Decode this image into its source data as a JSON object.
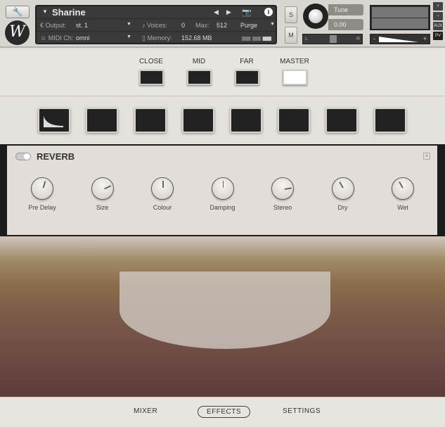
{
  "header": {
    "instrument_name": "Sharine",
    "output_label": "Output:",
    "output_value": "st. 1",
    "voices_label": "Voices:",
    "voices_value": "0",
    "max_label": "Max:",
    "max_value": "512",
    "midi_label": "MIDI Ch:",
    "midi_value": "omni",
    "memory_label": "Memory:",
    "memory_value": "152.68 MB",
    "purge_label": "Purge",
    "solo_label": "S",
    "mute_label": "M",
    "tune_label": "Tune",
    "tune_value": "0.00",
    "pan_left": "L",
    "pan_right": "R",
    "vol_minus": "-",
    "vol_plus": "+",
    "aux_label": "AUX",
    "pv_label": "PV",
    "close_glyph": "×",
    "min_glyph": "–",
    "logo": "W"
  },
  "mics": {
    "items": [
      {
        "label": "CLOSE",
        "active": false
      },
      {
        "label": "MID",
        "active": false
      },
      {
        "label": "FAR",
        "active": false
      },
      {
        "label": "MASTER",
        "active": true
      }
    ]
  },
  "effect": {
    "title": "REVERB",
    "enabled": true,
    "knobs": [
      {
        "label": "Pre Delay",
        "value": 0.56
      },
      {
        "label": "Size",
        "value": 0.74
      },
      {
        "label": "Colour",
        "value": 0.5
      },
      {
        "label": "Damping",
        "value": 0.5
      },
      {
        "label": "Stereo",
        "value": 0.8
      },
      {
        "label": "Dry",
        "value": 0.39
      },
      {
        "label": "Wet",
        "value": 0.39
      }
    ]
  },
  "footer": {
    "tabs": [
      {
        "label": "MIXER"
      },
      {
        "label": "EFFECTS",
        "active": true
      },
      {
        "label": "SETTINGS"
      }
    ]
  }
}
